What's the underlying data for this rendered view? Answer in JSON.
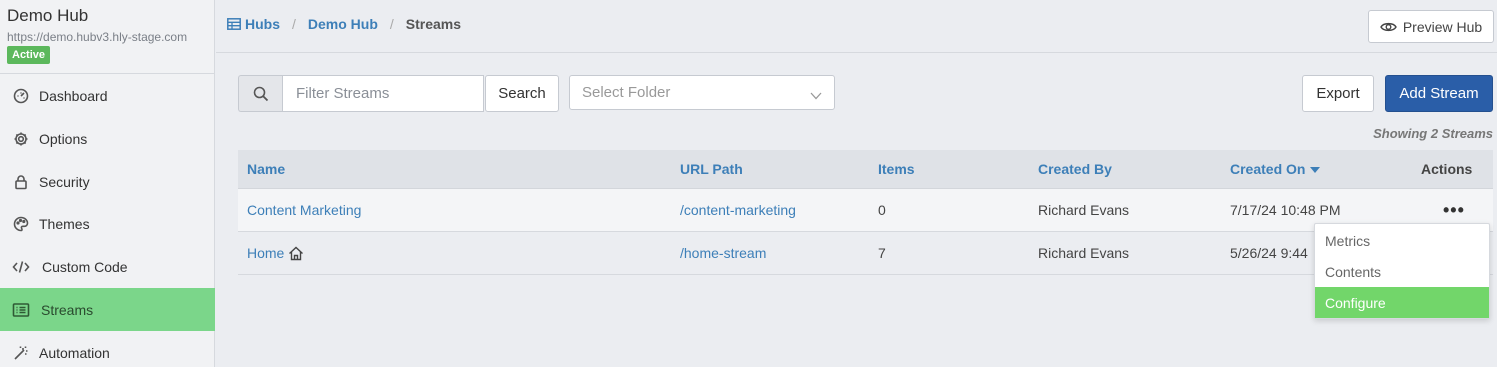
{
  "hub": {
    "title": "Demo Hub",
    "url": "https://demo.hubv3.hly-stage.com",
    "status": "Active"
  },
  "sidebar": {
    "items": [
      {
        "label": "Dashboard",
        "icon": "dashboard-icon"
      },
      {
        "label": "Options",
        "icon": "gear-icon"
      },
      {
        "label": "Security",
        "icon": "lock-icon"
      },
      {
        "label": "Themes",
        "icon": "palette-icon"
      },
      {
        "label": "Custom Code",
        "icon": "code-icon"
      },
      {
        "label": "Streams",
        "icon": "list-icon",
        "active": true
      },
      {
        "label": "Automation",
        "icon": "magic-wand-icon"
      }
    ]
  },
  "breadcrumb": {
    "hubs": "Hubs",
    "hub": "Demo Hub",
    "current": "Streams"
  },
  "header": {
    "preview_label": "Preview Hub"
  },
  "toolbar": {
    "filter_placeholder": "Filter Streams",
    "search_label": "Search",
    "folder_placeholder": "Select Folder",
    "export_label": "Export",
    "add_label": "Add Stream",
    "showing": "Showing 2 Streams"
  },
  "table": {
    "columns": [
      "Name",
      "URL Path",
      "Items",
      "Created By",
      "Created On",
      "Actions"
    ],
    "rows": [
      {
        "name": "Content Marketing",
        "url": "/content-marketing",
        "items": "0",
        "created_by": "Richard Evans",
        "created_on": "7/17/24 10:48 PM",
        "actions": "•••"
      },
      {
        "name": "Home",
        "url": "/home-stream",
        "items": "7",
        "created_by": "Richard Evans",
        "created_on": "5/26/24 9:44"
      }
    ]
  },
  "menu": {
    "items": [
      "Metrics",
      "Contents",
      "Configure"
    ],
    "highlighted": "Configure"
  },
  "colors": {
    "accent": "#3d7fb8",
    "primary_button": "#2a5ea8",
    "active_nav": "#7bd68a",
    "badge": "#5cb85c",
    "menu_highlight": "#72d66a"
  }
}
